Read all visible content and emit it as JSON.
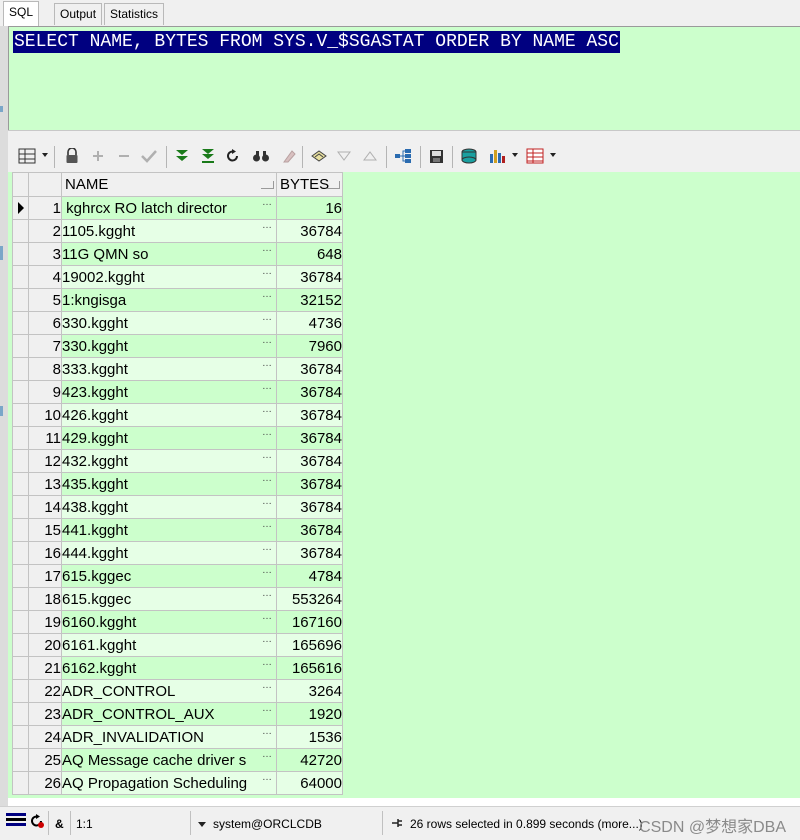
{
  "tabs": [
    {
      "label": "SQL",
      "active": true
    },
    {
      "label": "Output",
      "active": false
    },
    {
      "label": "Statistics",
      "active": false
    }
  ],
  "editor": {
    "sql": "SELECT NAME, BYTES FROM SYS.V_$SGASTAT ORDER BY NAME ASC",
    "background": "#ccffcc",
    "selection_color": "#000080"
  },
  "toolbar": {
    "icons": [
      "grid-menu-icon",
      "lock-icon",
      "add-record-icon",
      "delete-record-icon",
      "post-edit-icon",
      "fetch-next-page-icon",
      "fetch-last-page-icon",
      "refresh-icon",
      "find-icon",
      "clear-icon",
      "query-by-example-icon",
      "sort-descending-icon",
      "sort-ascending-icon",
      "export-tree-icon",
      "save-icon",
      "print-icon",
      "chart-icon",
      "export-icon"
    ]
  },
  "grid": {
    "columns": [
      "NAME",
      "BYTES"
    ],
    "current_row": 1,
    "rows": [
      {
        "n": "1",
        "name": " kghrcx RO latch director",
        "bytes": "16"
      },
      {
        "n": "2",
        "name": "1105.kgght",
        "bytes": "36784"
      },
      {
        "n": "3",
        "name": "11G QMN so",
        "bytes": "648"
      },
      {
        "n": "4",
        "name": "19002.kgght",
        "bytes": "36784"
      },
      {
        "n": "5",
        "name": "1:kngisga",
        "bytes": "32152"
      },
      {
        "n": "6",
        "name": "330.kgght",
        "bytes": "4736"
      },
      {
        "n": "7",
        "name": "330.kgght",
        "bytes": "7960"
      },
      {
        "n": "8",
        "name": "333.kgght",
        "bytes": "36784"
      },
      {
        "n": "9",
        "name": "423.kgght",
        "bytes": "36784"
      },
      {
        "n": "10",
        "name": "426.kgght",
        "bytes": "36784"
      },
      {
        "n": "11",
        "name": "429.kgght",
        "bytes": "36784"
      },
      {
        "n": "12",
        "name": "432.kgght",
        "bytes": "36784"
      },
      {
        "n": "13",
        "name": "435.kgght",
        "bytes": "36784"
      },
      {
        "n": "14",
        "name": "438.kgght",
        "bytes": "36784"
      },
      {
        "n": "15",
        "name": "441.kgght",
        "bytes": "36784"
      },
      {
        "n": "16",
        "name": "444.kgght",
        "bytes": "36784"
      },
      {
        "n": "17",
        "name": "615.kggec",
        "bytes": "4784"
      },
      {
        "n": "18",
        "name": "615.kggec",
        "bytes": "553264"
      },
      {
        "n": "19",
        "name": "6160.kgght",
        "bytes": "167160"
      },
      {
        "n": "20",
        "name": "6161.kgght",
        "bytes": "165696"
      },
      {
        "n": "21",
        "name": "6162.kgght",
        "bytes": "165616"
      },
      {
        "n": "22",
        "name": "ADR_CONTROL",
        "bytes": "3264"
      },
      {
        "n": "23",
        "name": "ADR_CONTROL_AUX",
        "bytes": "1920"
      },
      {
        "n": "24",
        "name": "ADR_INVALIDATION",
        "bytes": "1536"
      },
      {
        "n": "25",
        "name": "AQ Message cache driver s",
        "bytes": "42720"
      },
      {
        "n": "26",
        "name": "AQ Propagation Scheduling",
        "bytes": "64000"
      }
    ],
    "ellipsis": "…"
  },
  "status": {
    "position": "1:1",
    "connection": "system@ORCLCDB",
    "message": "26 rows selected in 0.899 seconds (more...)",
    "modifier": "&",
    "watermark": "CSDN @梦想家DBA"
  },
  "colors": {
    "grid_odd": "#ccffcc",
    "grid_even": "#e6ffe6"
  }
}
